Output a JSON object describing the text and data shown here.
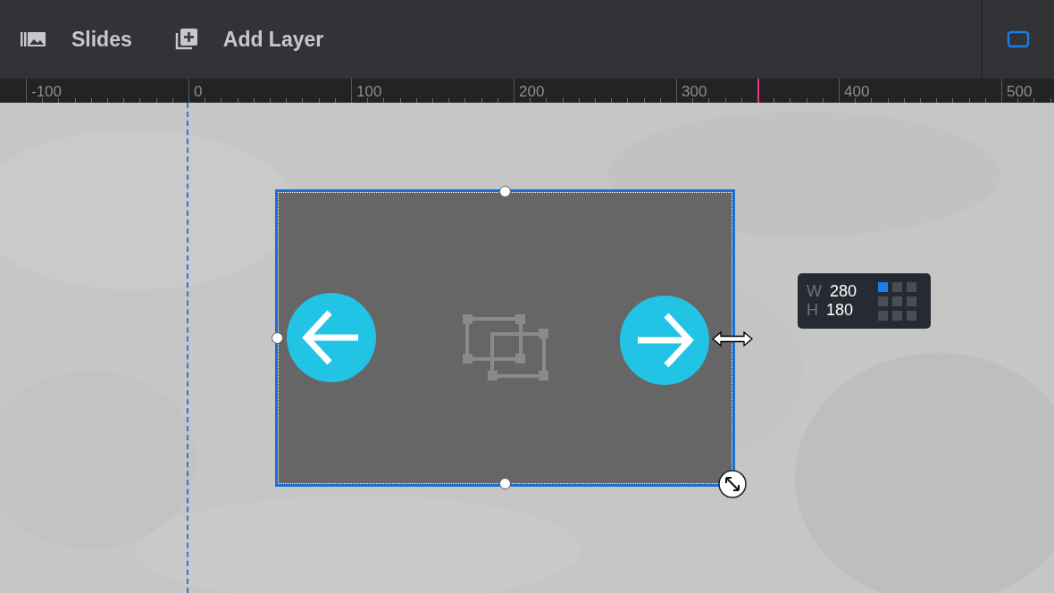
{
  "toolbar": {
    "buttons": [
      {
        "kind": "slides",
        "label": "Slides"
      },
      {
        "kind": "add-layer",
        "label": "Add Layer"
      }
    ]
  },
  "ruler": {
    "labels": [
      "-100",
      "0",
      "100",
      "200",
      "300",
      "400",
      "500"
    ]
  },
  "layer": {
    "selected": true
  },
  "size_panel": {
    "w_label": "W",
    "w_value": "280",
    "h_label": "H",
    "h_value": "180",
    "anchor": [
      {
        "selected": true
      },
      {
        "selected": false
      },
      {
        "selected": false
      },
      {
        "selected": false
      },
      {
        "selected": false
      },
      {
        "selected": false
      },
      {
        "selected": false
      },
      {
        "selected": false
      },
      {
        "selected": false
      }
    ]
  }
}
